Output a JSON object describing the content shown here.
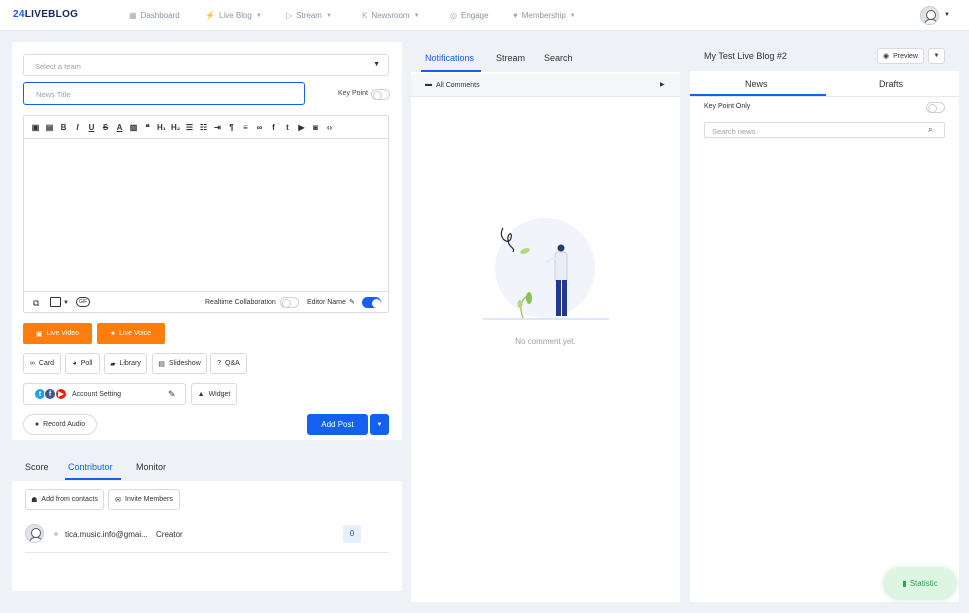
{
  "nav": {
    "logo_prefix": "24",
    "logo_text": "LIVEBLOG",
    "items": [
      {
        "label": "Dashboard",
        "icon": "dashboard-icon"
      },
      {
        "label": "Live Blog",
        "icon": "bolt-icon"
      },
      {
        "label": "Stream",
        "icon": "play-icon"
      },
      {
        "label": "Newsroom",
        "icon": "newsroom-icon"
      },
      {
        "label": "Engage",
        "icon": "target-icon"
      },
      {
        "label": "Membership",
        "icon": "heart-icon"
      }
    ]
  },
  "editor": {
    "team_placeholder": "Select a team",
    "title_placeholder": "News Title",
    "key_point": "Key Point",
    "realtime": "Realtime Collaboration",
    "editor_name": "Editor Name",
    "live_video": "Live Video",
    "live_voice": "Live Voice",
    "card": "Card",
    "poll": "Poll",
    "library": "Library",
    "slideshow": "Slideshow",
    "qa": "Q&A",
    "account_setting": "Account Setting",
    "widget": "Widget",
    "record_audio": "Record Audio",
    "add_post": "Add Post"
  },
  "contrib": {
    "tabs": [
      "Score",
      "Contributor",
      "Monitor"
    ],
    "active_tab": "Contributor",
    "add_contacts": "Add from contacts",
    "invite": "Invite Members",
    "user_email": "tica.music.info@gmai...",
    "user_role": "Creator",
    "user_count": "0"
  },
  "notif": {
    "tabs": [
      "Notifications",
      "Stream",
      "Search"
    ],
    "active_tab": "Notifications",
    "filter": "All Comments",
    "empty": "No comment yet."
  },
  "blog": {
    "title": "My Test Live Blog #2",
    "preview": "Preview",
    "tabs": [
      "News",
      "Drafts"
    ],
    "active_tab": "News",
    "key_point_only": "Key Point Only",
    "search_placeholder": "Search news"
  },
  "statistic": "Statistic",
  "colors": {
    "accent": "#1660f0",
    "orange": "#fa7d0d",
    "statistic_bg": "#dff5e3"
  }
}
